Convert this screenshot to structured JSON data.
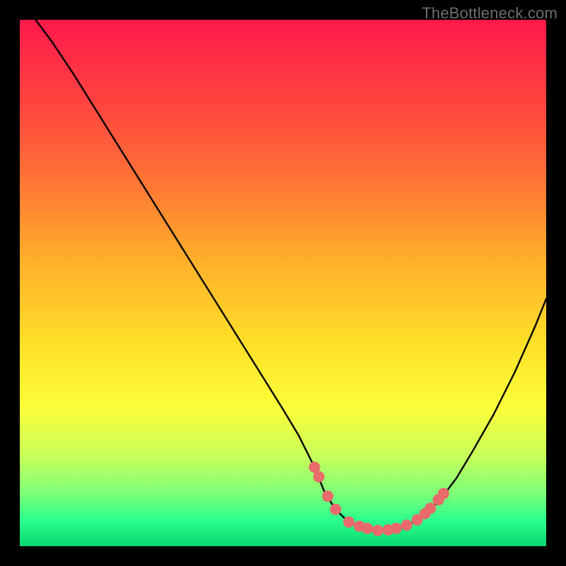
{
  "watermark": "TheBottleneck.com",
  "chart_data": {
    "type": "line",
    "title": "",
    "xlabel": "",
    "ylabel": "",
    "xlim": [
      0,
      100
    ],
    "ylim": [
      0,
      100
    ],
    "grid": false,
    "series": [
      {
        "name": "bottleneck-curve",
        "x": [
          3,
          6,
          10,
          15,
          20,
          25,
          30,
          35,
          40,
          45,
          50,
          53,
          56,
          58,
          60,
          62,
          65,
          68,
          71,
          74,
          77,
          80,
          83,
          86,
          90,
          94,
          98,
          100
        ],
        "y": [
          100,
          96,
          90,
          82,
          74,
          66,
          58,
          50,
          42,
          34,
          26,
          21,
          15,
          10,
          7,
          5,
          3.5,
          3,
          3.3,
          4.2,
          6,
          9,
          13,
          18,
          25,
          33,
          42,
          47
        ]
      }
    ],
    "markers": {
      "name": "highlight-points",
      "color": "#e96a6a",
      "x": [
        56,
        56.8,
        58.5,
        60,
        62.5,
        64.5,
        66,
        68,
        70,
        71.5,
        73.5,
        75.5,
        77,
        78,
        79.5,
        80.5
      ],
      "y": [
        15,
        13.2,
        9.5,
        7,
        4.6,
        3.8,
        3.4,
        3,
        3.1,
        3.4,
        4,
        5,
        6.2,
        7.2,
        8.8,
        10
      ]
    },
    "gradient_stops": [
      {
        "pos": 0,
        "color": "#ff1a4b"
      },
      {
        "pos": 18,
        "color": "#ff4a3e"
      },
      {
        "pos": 32,
        "color": "#ff7a34"
      },
      {
        "pos": 46,
        "color": "#ffb02a"
      },
      {
        "pos": 62,
        "color": "#ffe128"
      },
      {
        "pos": 74,
        "color": "#f9ff3a"
      },
      {
        "pos": 83,
        "color": "#c7ff5a"
      },
      {
        "pos": 90,
        "color": "#7dff78"
      },
      {
        "pos": 95,
        "color": "#2bff8e"
      },
      {
        "pos": 100,
        "color": "#08d870"
      }
    ]
  }
}
